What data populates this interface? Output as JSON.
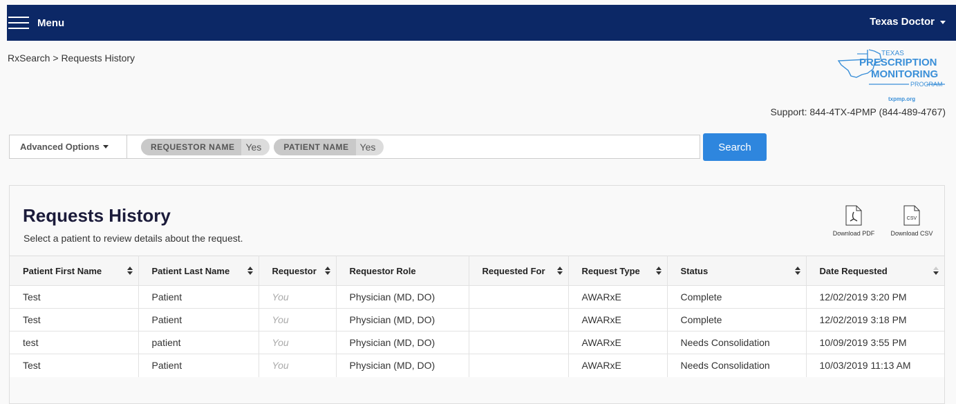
{
  "header": {
    "menu_label": "Menu",
    "user_name": "Texas Doctor"
  },
  "breadcrumb": {
    "root": "RxSearch",
    "separator": ">",
    "current": "Requests History"
  },
  "logo": {
    "line1": "TEXAS",
    "line2": "PRESCRIPTION",
    "line3": "MONITORING",
    "line4": "PROGRAM",
    "url": "txpmp.org",
    "color": "#3a8fd8"
  },
  "support": {
    "text": "Support: 844-4TX-4PMP (844-489-4767)"
  },
  "search": {
    "advanced_options_label": "Advanced Options",
    "filters": [
      {
        "key": "REQUESTOR NAME",
        "value": "Yes"
      },
      {
        "key": "PATIENT NAME",
        "value": "Yes"
      }
    ],
    "button_label": "Search",
    "button_color": "#2e86de"
  },
  "panel": {
    "title": "Requests History",
    "subtitle": "Select a patient to review details about the request.",
    "download_pdf_label": "Download PDF",
    "download_csv_label": "Download CSV",
    "csv_icon_text": "CSV"
  },
  "table": {
    "columns": [
      "Patient First Name",
      "Patient Last Name",
      "Requestor",
      "Requestor Role",
      "Requested For",
      "Request Type",
      "Status",
      "Date Requested"
    ],
    "rows": [
      [
        "Test",
        "Patient",
        "You",
        "Physician (MD, DO)",
        "",
        "AWARxE",
        "Complete",
        "12/02/2019 3:20 PM"
      ],
      [
        "Test",
        "Patient",
        "You",
        "Physician (MD, DO)",
        "",
        "AWARxE",
        "Complete",
        "12/02/2019 3:18 PM"
      ],
      [
        "test",
        "patient",
        "You",
        "Physician (MD, DO)",
        "",
        "AWARxE",
        "Needs Consolidation",
        "10/09/2019 3:55 PM"
      ],
      [
        "Test",
        "Patient",
        "You",
        "Physician (MD, DO)",
        "",
        "AWARxE",
        "Needs Consolidation",
        "10/03/2019 11:13 AM"
      ]
    ]
  },
  "colors": {
    "navbar": "#0c2866",
    "title": "#1b1b3a"
  }
}
